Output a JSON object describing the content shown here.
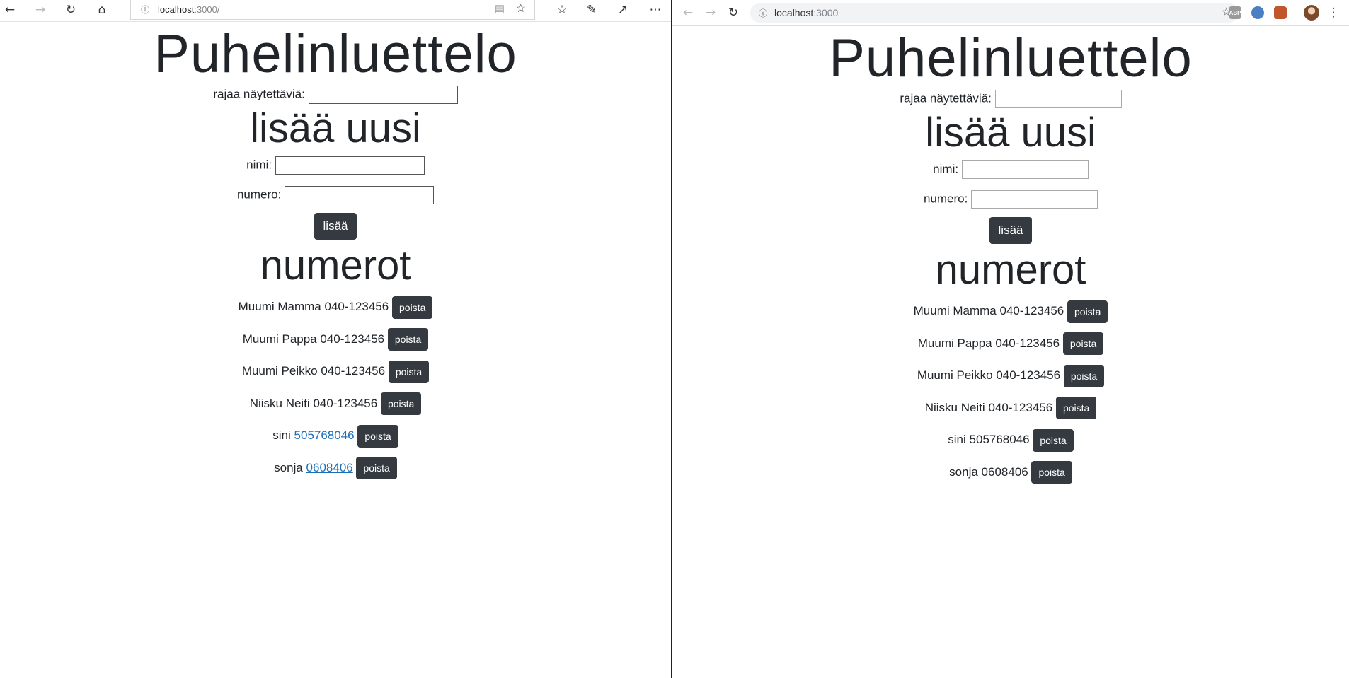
{
  "edge": {
    "url_host": "localhost",
    "url_rest": ":3000/",
    "app": {
      "title": "Puhelinluettelo",
      "filter_label": "rajaa näytettäviä:",
      "filter_value": "",
      "add_heading": "lisää uusi",
      "name_label": "nimi:",
      "number_label": "numero:",
      "add_button": "lisää",
      "list_heading": "numerot",
      "delete_label": "poista",
      "persons": [
        {
          "name": "Muumi Mamma",
          "number": "040-123456"
        },
        {
          "name": "Muumi Pappa",
          "number": "040-123456"
        },
        {
          "name": "Muumi Peikko",
          "number": "040-123456"
        },
        {
          "name": "Niisku Neiti",
          "number": "040-123456"
        },
        {
          "name": "sini",
          "number": "505768046"
        },
        {
          "name": "sonja",
          "number": "0608406"
        }
      ]
    }
  },
  "chrome": {
    "url_host": "localhost",
    "url_rest": ":3000",
    "app": {
      "title": "Puhelinluettelo",
      "filter_label": "rajaa näytettäviä:",
      "add_heading": "lisää uusi",
      "name_label": "nimi:",
      "number_label": "numero:",
      "add_button": "lisää",
      "list_heading": "numerot",
      "delete_label": "poista",
      "persons": [
        {
          "name": "Muumi Mamma",
          "number": "040-123456"
        },
        {
          "name": "Muumi Pappa",
          "number": "040-123456"
        },
        {
          "name": "Muumi Peikko",
          "number": "040-123456"
        },
        {
          "name": "Niisku Neiti",
          "number": "040-123456"
        },
        {
          "name": "sini",
          "number": "505768046"
        },
        {
          "name": "sonja",
          "number": "0608406"
        }
      ]
    }
  },
  "colors": {
    "button_bg": "#343a40",
    "link": "#1a6fb8"
  },
  "extensions": [
    "ABP",
    "ext-2",
    "ext-3"
  ]
}
